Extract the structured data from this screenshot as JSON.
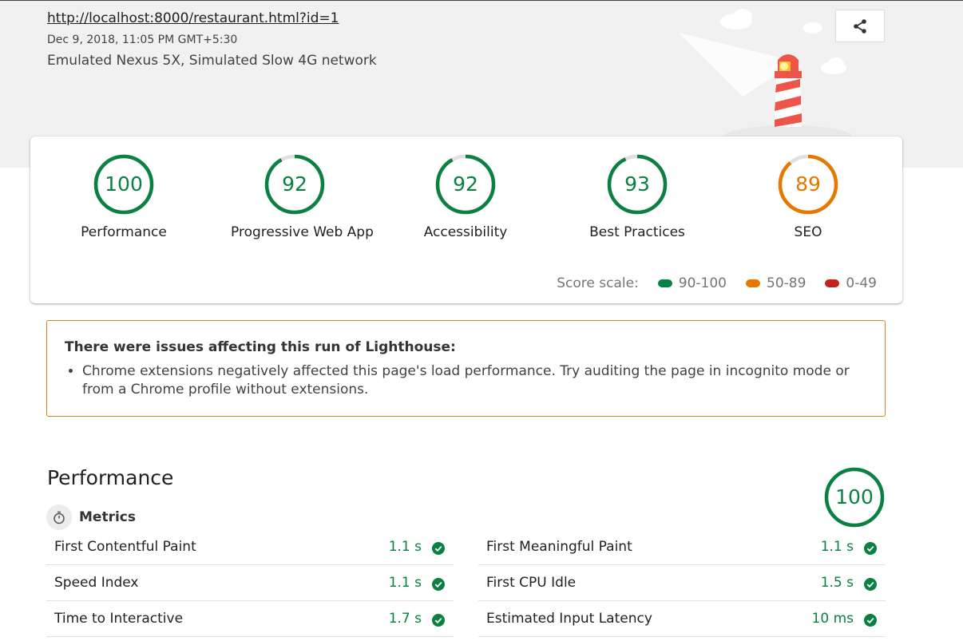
{
  "header": {
    "url": "http://localhost:8000/restaurant.html?id=1",
    "date": "Dec 9, 2018, 11:05 PM GMT+5:30",
    "environment": "Emulated Nexus 5X, Simulated Slow 4G network",
    "share_icon": "share-icon"
  },
  "categories": [
    {
      "score": "100",
      "label": "Performance",
      "fraction": 1.0,
      "color": "#0b8043"
    },
    {
      "score": "92",
      "label": "Progressive Web App",
      "fraction": 0.92,
      "color": "#0b8043"
    },
    {
      "score": "92",
      "label": "Accessibility",
      "fraction": 0.92,
      "color": "#0b8043"
    },
    {
      "score": "93",
      "label": "Best Practices",
      "fraction": 0.93,
      "color": "#0b8043"
    },
    {
      "score": "89",
      "label": "SEO",
      "fraction": 0.89,
      "color": "#e67700"
    }
  ],
  "score_scale": {
    "label": "Score scale:",
    "items": [
      {
        "range": "90-100",
        "color": "#0b8043"
      },
      {
        "range": "50-89",
        "color": "#e67700"
      },
      {
        "range": "0-49",
        "color": "#c5221f"
      }
    ]
  },
  "warning": {
    "title": "There were issues affecting this run of Lighthouse:",
    "items": [
      "Chrome extensions negatively affected this page's load performance. Try auditing the page in incognito mode or from a Chrome profile without extensions."
    ]
  },
  "performance": {
    "title": "Performance",
    "score": "100",
    "metrics_label": "Metrics",
    "metrics": [
      {
        "name": "First Contentful Paint",
        "value": "1.1 s"
      },
      {
        "name": "First Meaningful Paint",
        "value": "1.1 s"
      },
      {
        "name": "Speed Index",
        "value": "1.1 s"
      },
      {
        "name": "First CPU Idle",
        "value": "1.5 s"
      },
      {
        "name": "Time to Interactive",
        "value": "1.7 s"
      },
      {
        "name": "Estimated Input Latency",
        "value": "10 ms"
      }
    ]
  }
}
